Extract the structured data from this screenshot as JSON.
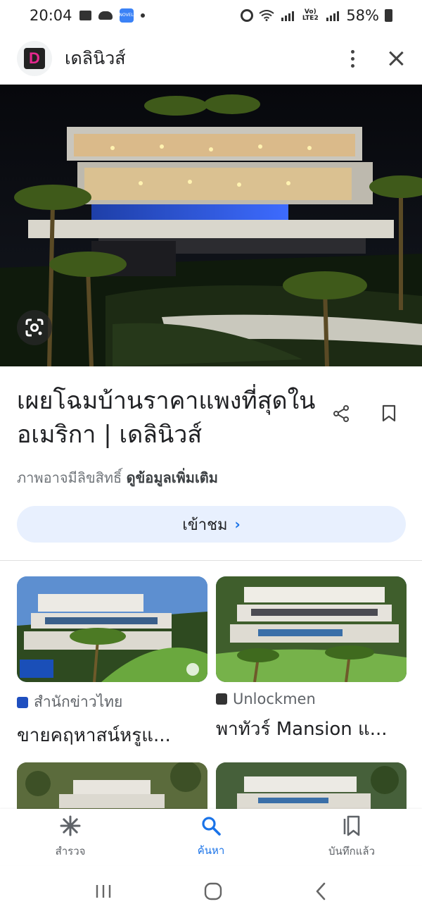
{
  "status_bar": {
    "time": "20:04",
    "app_badge": "NOVEL TOON",
    "lte_label": "Vo) LTE2",
    "battery": "58%"
  },
  "header": {
    "logo_letter": "D",
    "site_name": "เดลินิวส์"
  },
  "result": {
    "title": "เผยโฉมบ้านราคาแพงที่สุดในอเมริกา | เดลินิวส์",
    "copyright_note": "ภาพอาจมีลิขสิทธิ์",
    "more_info": "ดูข้อมูลเพิ่มเติม",
    "visit_label": "เข้าชม",
    "visit_chevron": "›"
  },
  "related": [
    {
      "source": "สำนักข่าวไทย",
      "title": "ขายคฤหาสน์หรูแ...",
      "source_icon": "mcot-logo-icon"
    },
    {
      "source": "Unlockmen",
      "title": "พาทัวร์ Mansion แ...",
      "source_icon": "unlockmen-logo-icon"
    }
  ],
  "bottom_nav": {
    "explore": "สำรวจ",
    "search": "ค้นหา",
    "saved": "บันทึกแล้ว"
  },
  "colors": {
    "accent": "#1a73e8",
    "visit_bg": "#e8f0fe"
  }
}
